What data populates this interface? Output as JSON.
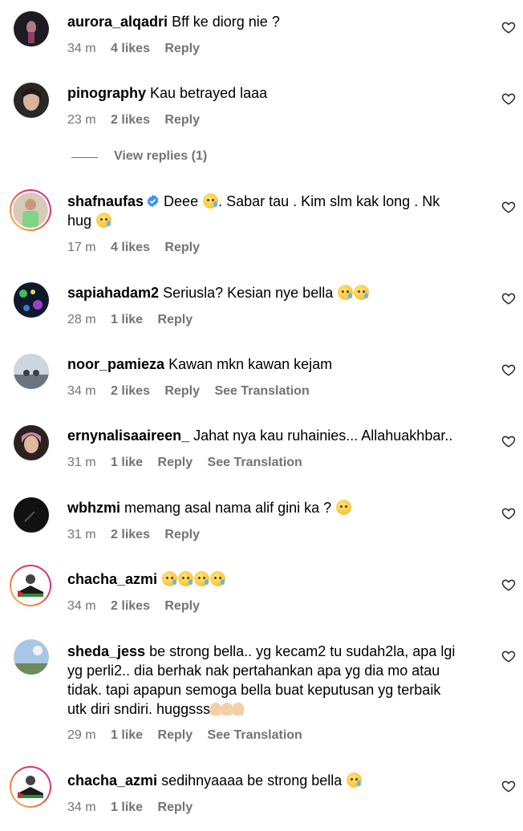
{
  "ui": {
    "verified_color": "#3897f0",
    "meta_color": "#737373",
    "reply_label": "Reply",
    "see_translation_label": "See Translation",
    "heart_icon": "heart-outline-icon"
  },
  "view_replies": {
    "label": "View replies (1)"
  },
  "comments": [
    {
      "username": "aurora_alqadri",
      "verified": false,
      "text_lines": [
        "Bff ke diorg nie ?"
      ],
      "time": "34 m",
      "likes": "4 likes",
      "see_translation": false
    },
    {
      "username": "pinography",
      "verified": false,
      "text_lines": [
        "Kau betrayed laaa"
      ],
      "time": "23 m",
      "likes": "2 likes",
      "see_translation": false
    },
    {
      "username": "shafnaufas",
      "verified": true,
      "text_lines": [
        "Deee",
        ". Sabar tau . Kim slm kak long . Nk",
        "hug"
      ],
      "time": "17 m",
      "likes": "4 likes",
      "see_translation": false
    },
    {
      "username": "sapiahadam2",
      "verified": false,
      "text_lines": [
        "Seriusla? Kesian nye bella"
      ],
      "time": "28 m",
      "likes": "1 like",
      "see_translation": false
    },
    {
      "username": "noor_pamieza",
      "verified": false,
      "text_lines": [
        "Kawan mkn kawan kejam"
      ],
      "time": "34 m",
      "likes": "2 likes",
      "see_translation": true
    },
    {
      "username": "ernynalisaaireen_",
      "verified": false,
      "text_lines": [
        "Jahat nya kau ruhainies... Allahuakhbar.."
      ],
      "time": "31 m",
      "likes": "1 like",
      "see_translation": true
    },
    {
      "username": "wbhzmi",
      "verified": false,
      "text_lines": [
        "memang asal nama alif gini ka ?"
      ],
      "time": "31 m",
      "likes": "2 likes",
      "see_translation": false
    },
    {
      "username": "chacha_azmi",
      "verified": false,
      "text_lines": [
        ""
      ],
      "time": "34 m",
      "likes": "2 likes",
      "see_translation": false
    },
    {
      "username": "sheda_jess",
      "verified": false,
      "text_lines": [
        "be strong bella.. yg kecam2 tu sudah2la, apa lgi",
        "yg perli2.. dia berhak nak pertahankan apa yg dia mo atau",
        "tidak. tapi apapun semoga bella buat keputusan yg terbaik",
        "utk diri sndiri. huggsss"
      ],
      "time": "29 m",
      "likes": "1 like",
      "see_translation": true
    },
    {
      "username": "chacha_azmi",
      "verified": false,
      "text_lines": [
        "sedihnyaaaa be strong bella"
      ],
      "time": "34 m",
      "likes": "1 like",
      "see_translation": false
    }
  ]
}
